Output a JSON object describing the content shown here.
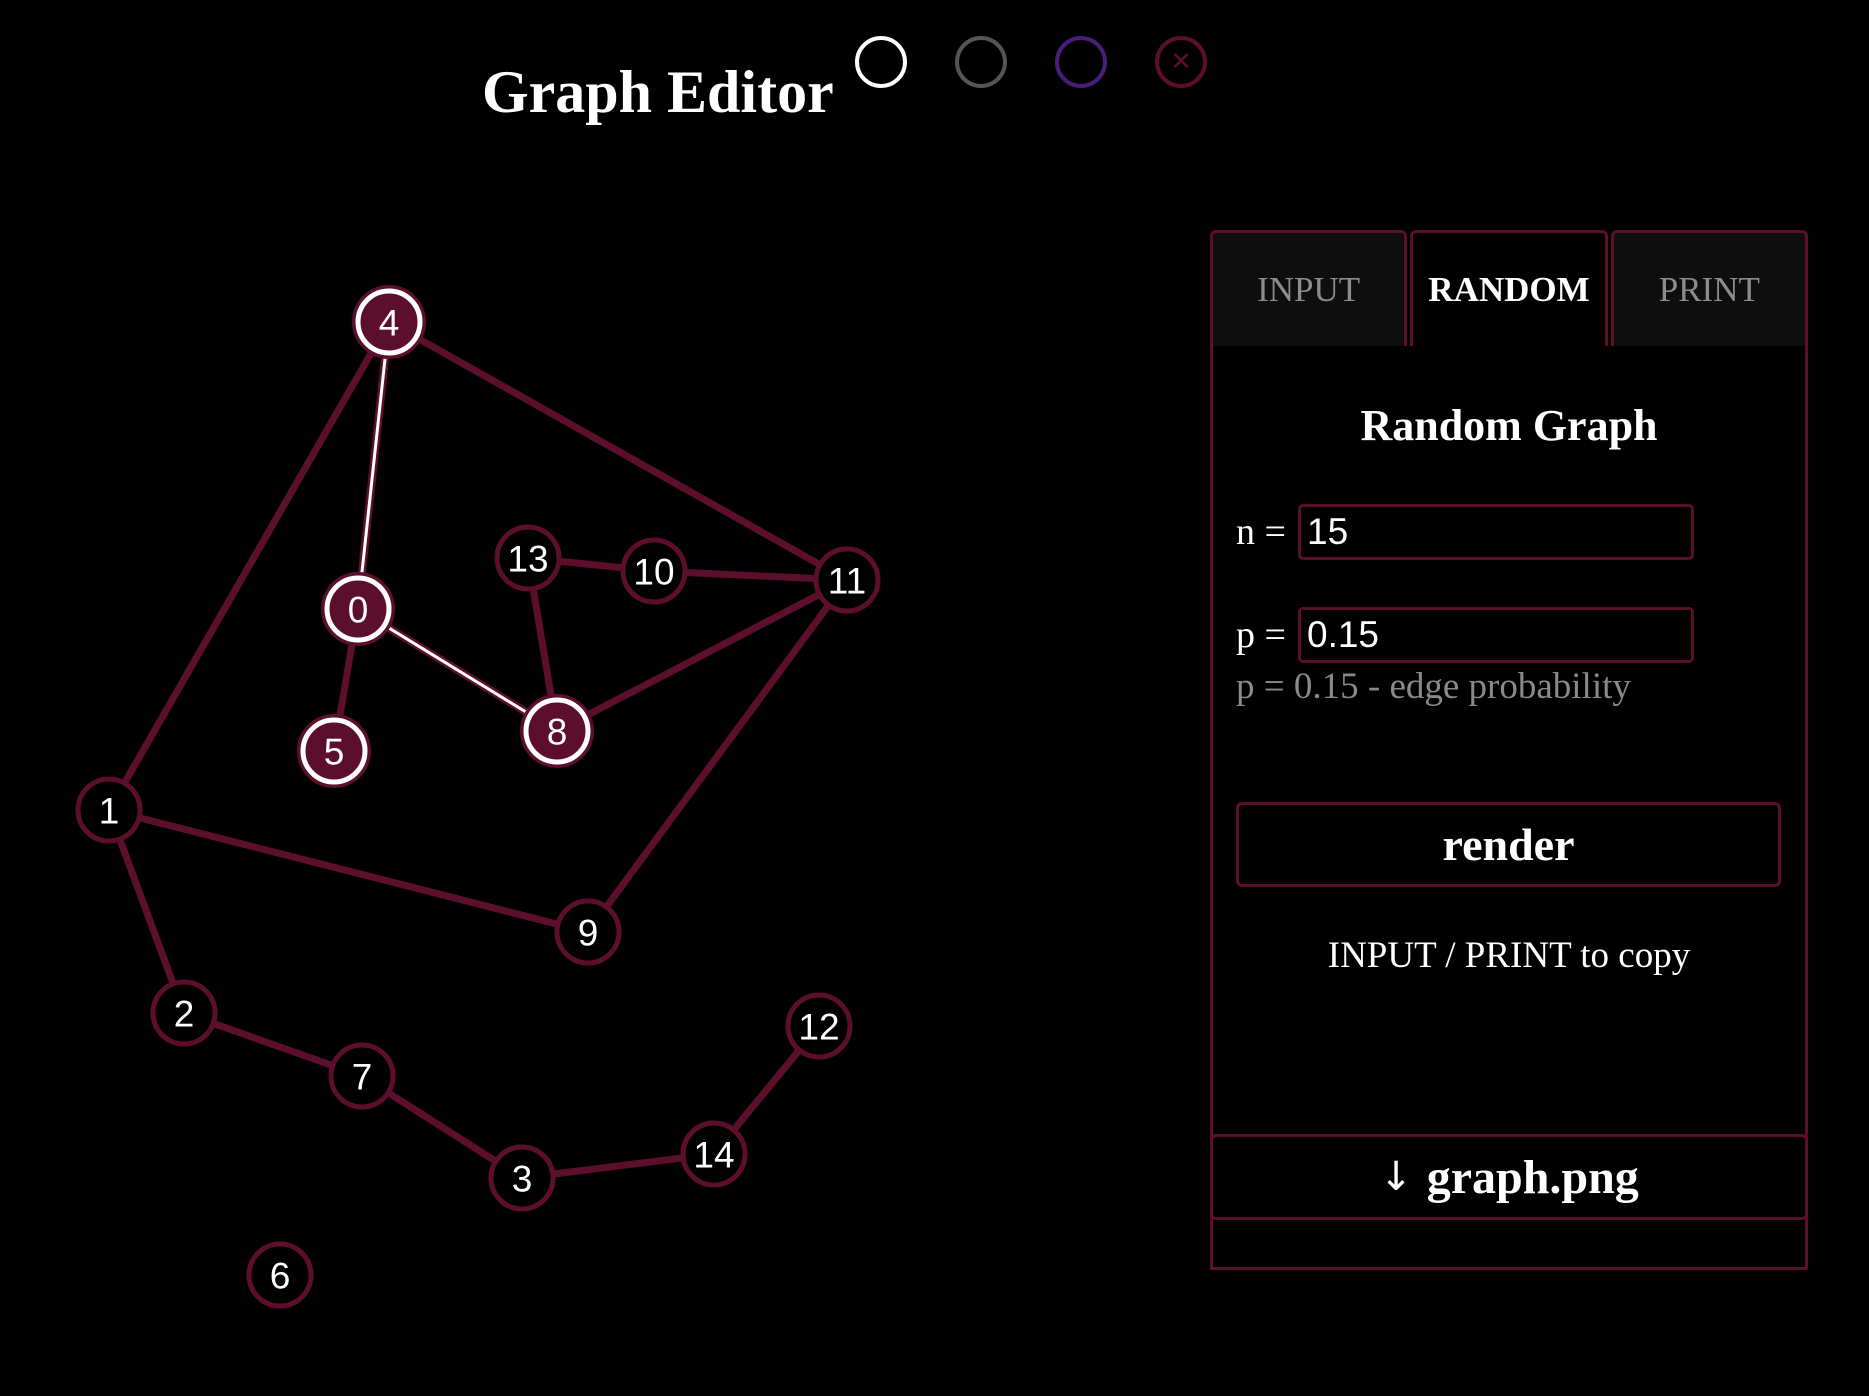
{
  "header": {
    "title": "Graph Editor",
    "theme_buttons": [
      {
        "name": "white-theme",
        "color": "#ffffff",
        "icon": ""
      },
      {
        "name": "gray-theme",
        "color": "#555555",
        "icon": ""
      },
      {
        "name": "purple-theme",
        "color": "#4a1d7a",
        "icon": ""
      },
      {
        "name": "close-theme",
        "color": "#5c0f2c",
        "icon": "✕"
      }
    ]
  },
  "colors": {
    "accent": "#5c0f2c",
    "node_fill": "#000000",
    "node_fill_selected": "#5c0f2c",
    "node_stroke": "#5c0f2c",
    "node_stroke_selected": "#ffffff",
    "edge": "#5c0f2c",
    "edge_selected": "#ffffff"
  },
  "graph": {
    "nodes": [
      {
        "id": "0",
        "selected": true
      },
      {
        "id": "1",
        "selected": false
      },
      {
        "id": "2",
        "selected": false
      },
      {
        "id": "3",
        "selected": false
      },
      {
        "id": "4",
        "selected": true
      },
      {
        "id": "5",
        "selected": true
      },
      {
        "id": "6",
        "selected": false
      },
      {
        "id": "7",
        "selected": false
      },
      {
        "id": "8",
        "selected": true
      },
      {
        "id": "9",
        "selected": false
      },
      {
        "id": "10",
        "selected": false
      },
      {
        "id": "11",
        "selected": false
      },
      {
        "id": "12",
        "selected": false
      },
      {
        "id": "13",
        "selected": false
      },
      {
        "id": "14",
        "selected": false
      }
    ],
    "edges": [
      {
        "from": "4",
        "to": "0",
        "selected": true
      },
      {
        "from": "0",
        "to": "8",
        "selected": true
      },
      {
        "from": "0",
        "to": "5",
        "selected": false
      },
      {
        "from": "4",
        "to": "1",
        "selected": false
      },
      {
        "from": "4",
        "to": "11",
        "selected": false
      },
      {
        "from": "13",
        "to": "10",
        "selected": false
      },
      {
        "from": "10",
        "to": "11",
        "selected": false
      },
      {
        "from": "13",
        "to": "8",
        "selected": false
      },
      {
        "from": "8",
        "to": "11",
        "selected": false
      },
      {
        "from": "11",
        "to": "9",
        "selected": false
      },
      {
        "from": "1",
        "to": "9",
        "selected": false
      },
      {
        "from": "1",
        "to": "2",
        "selected": false
      },
      {
        "from": "2",
        "to": "7",
        "selected": false
      },
      {
        "from": "7",
        "to": "3",
        "selected": false
      },
      {
        "from": "3",
        "to": "14",
        "selected": false
      },
      {
        "from": "14",
        "to": "12",
        "selected": false
      }
    ]
  },
  "panel": {
    "tabs": [
      {
        "label": "INPUT",
        "active": false
      },
      {
        "label": "RANDOM",
        "active": true
      },
      {
        "label": "PRINT",
        "active": false
      }
    ],
    "random": {
      "title": "Random Graph",
      "n_label": "n =",
      "n_value": "15",
      "p_label": "p =",
      "p_value": "0.15",
      "hint": "p = 0.15 - edge probability",
      "render_label": "render",
      "copy_note": "INPUT / PRINT to copy"
    }
  },
  "download": {
    "icon": "download-arrow-icon",
    "label": "graph.png"
  }
}
